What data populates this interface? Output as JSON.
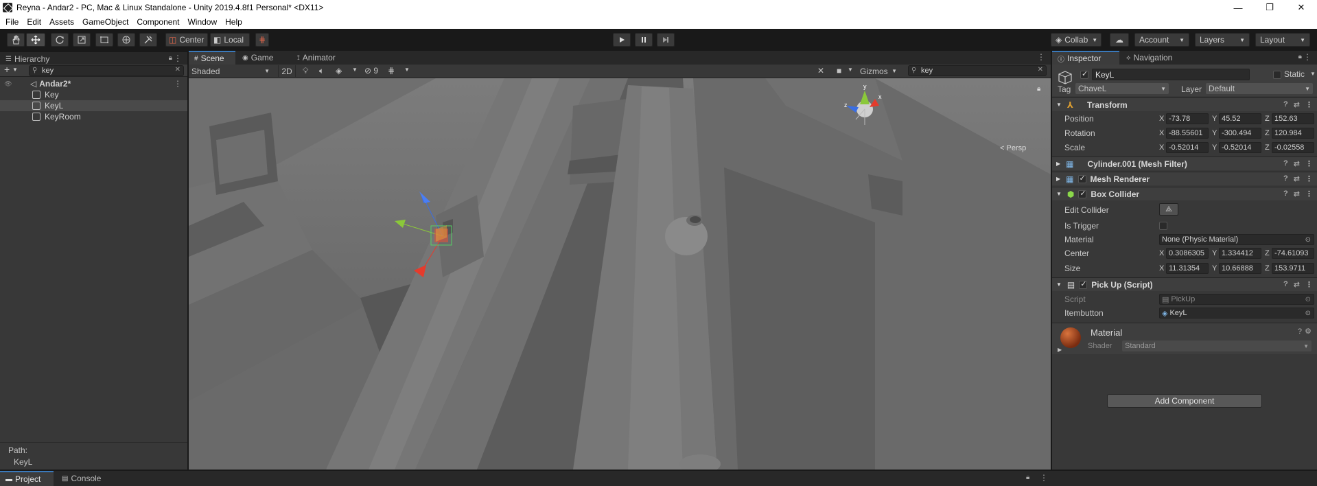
{
  "window": {
    "title": "Reyna - Andar2 - PC, Mac & Linux Standalone - Unity 2019.4.8f1 Personal* <DX11>",
    "minimize": "—",
    "maximize": "❐",
    "close": "✕"
  },
  "menu": [
    "File",
    "Edit",
    "Assets",
    "GameObject",
    "Component",
    "Window",
    "Help"
  ],
  "toolbar": {
    "pivot": "Center",
    "space": "Local",
    "collab": "Collab",
    "account": "Account",
    "layers": "Layers",
    "layout": "Layout"
  },
  "hierarchy": {
    "tab": "Hierarchy",
    "search": "key",
    "scene": "Andar2*",
    "items": [
      "Key",
      "KeyL",
      "KeyRoom"
    ],
    "path_label": "Path:",
    "path_value": "KeyL"
  },
  "scene_tabs": [
    "Scene",
    "Game",
    "Animator"
  ],
  "scene_toolbar": {
    "shading": "Shaded",
    "mode_2d": "2D",
    "hidden_count": "9",
    "gizmos": "Gizmos",
    "search": "key",
    "persp": "< Persp"
  },
  "inspector": {
    "tabs": [
      "Inspector",
      "Navigation"
    ],
    "object_name": "KeyL",
    "static_label": "Static",
    "tag_label": "Tag",
    "tag_value": "ChaveL",
    "layer_label": "Layer",
    "layer_value": "Default",
    "transform": {
      "title": "Transform",
      "position_label": "Position",
      "position": [
        "-73.78",
        "45.52",
        "152.63"
      ],
      "rotation_label": "Rotation",
      "rotation": [
        "-88.55601",
        "-300.494",
        "120.984"
      ],
      "scale_label": "Scale",
      "scale": [
        "-0.52014",
        "-0.52014",
        "-0.02558"
      ]
    },
    "mesh_filter": "Cylinder.001 (Mesh Filter)",
    "mesh_renderer": "Mesh Renderer",
    "box_collider": {
      "title": "Box Collider",
      "edit_collider": "Edit Collider",
      "is_trigger": "Is Trigger",
      "material_label": "Material",
      "material_value": "None (Physic Material)",
      "center_label": "Center",
      "center": [
        "0.3086305",
        "1.334412",
        "-74.61093"
      ],
      "size_label": "Size",
      "size": [
        "11.31354",
        "10.66888",
        "153.9711"
      ]
    },
    "pickup": {
      "title": "Pick Up (Script)",
      "script_label": "Script",
      "script_value": "PickUp",
      "itembutton_label": "Itembutton",
      "itembutton_value": "KeyL"
    },
    "material": {
      "title": "Material",
      "shader_label": "Shader",
      "shader_value": "Standard"
    },
    "add_component": "Add Component"
  },
  "bottom_tabs": [
    "Project",
    "Console"
  ],
  "axes": [
    "X",
    "Y",
    "Z"
  ],
  "colors": {
    "accent": "#3a79bb",
    "selection": "#4a4a4a",
    "gizmo_x": "#e53b2c",
    "gizmo_y": "#8bc83a",
    "gizmo_z": "#3a6ee5"
  }
}
